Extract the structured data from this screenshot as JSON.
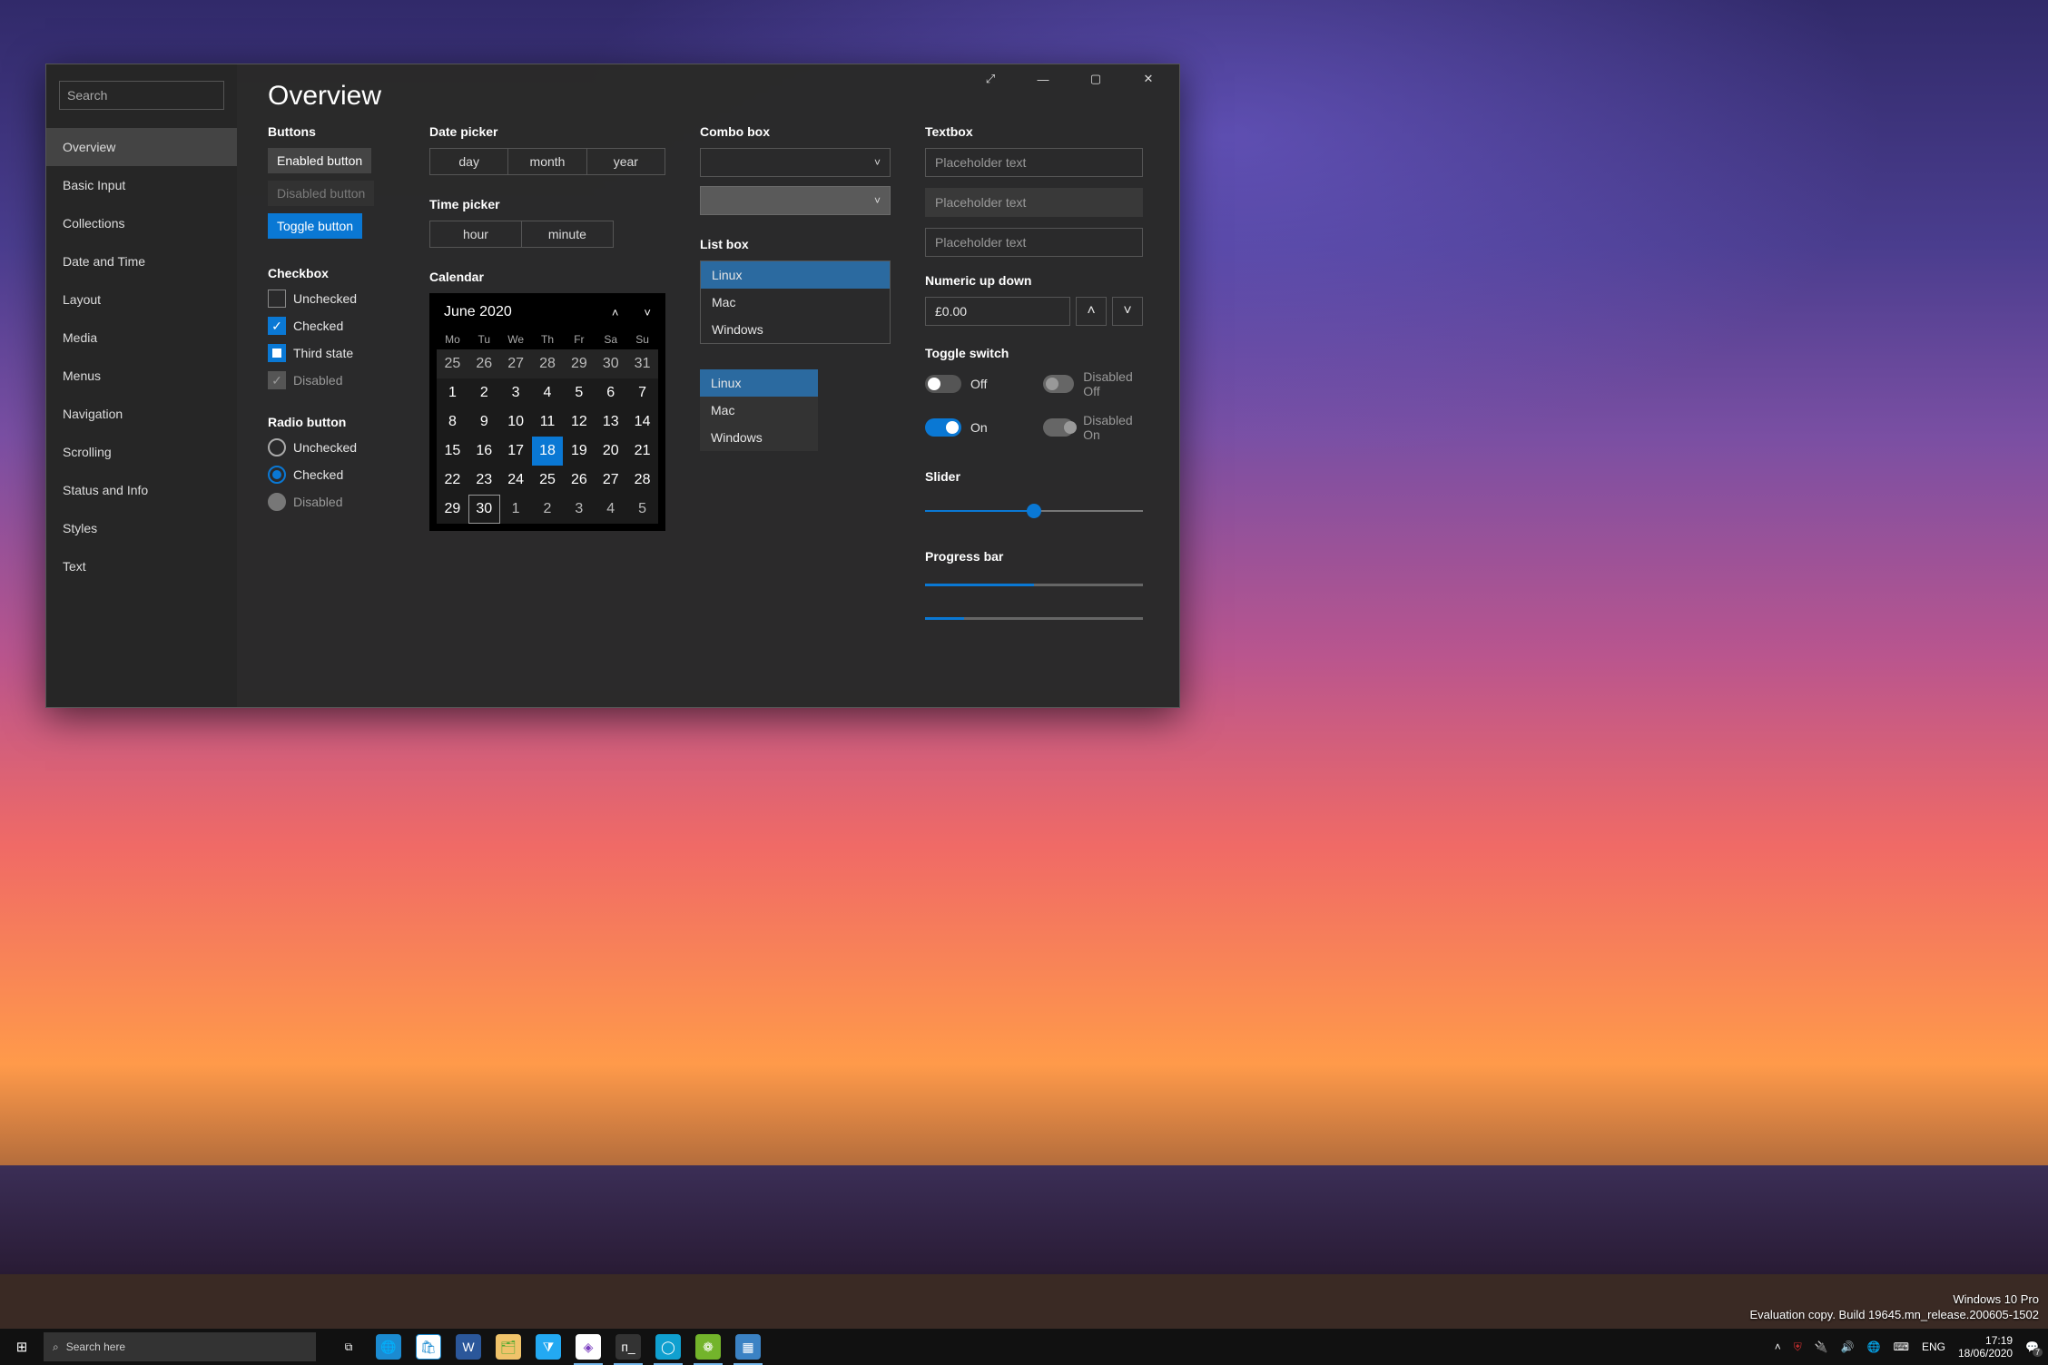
{
  "sidebar": {
    "search_placeholder": "Search",
    "items": [
      "Overview",
      "Basic Input",
      "Collections",
      "Date and Time",
      "Layout",
      "Media",
      "Menus",
      "Navigation",
      "Scrolling",
      "Status and Info",
      "Styles",
      "Text"
    ],
    "active_index": 0
  },
  "page_title": "Overview",
  "buttons": {
    "heading": "Buttons",
    "enabled_label": "Enabled button",
    "disabled_label": "Disabled button",
    "toggle_label": "Toggle button"
  },
  "checkbox": {
    "heading": "Checkbox",
    "unchecked_label": "Unchecked",
    "checked_label": "Checked",
    "third_label": "Third state",
    "disabled_label": "Disabled"
  },
  "radio": {
    "heading": "Radio button",
    "unchecked_label": "Unchecked",
    "checked_label": "Checked",
    "disabled_label": "Disabled"
  },
  "datepicker": {
    "heading": "Date picker",
    "day": "day",
    "month": "month",
    "year": "year"
  },
  "timepicker": {
    "heading": "Time picker",
    "hour": "hour",
    "minute": "minute"
  },
  "calendar": {
    "heading": "Calendar",
    "month_label": "June 2020",
    "dow": [
      "Mo",
      "Tu",
      "We",
      "Th",
      "Fr",
      "Sa",
      "Su"
    ],
    "days": [
      {
        "n": "25",
        "cls": "prev"
      },
      {
        "n": "26",
        "cls": "prev"
      },
      {
        "n": "27",
        "cls": "prev"
      },
      {
        "n": "28",
        "cls": "prev"
      },
      {
        "n": "29",
        "cls": "prev"
      },
      {
        "n": "30",
        "cls": "prev"
      },
      {
        "n": "31",
        "cls": "prev"
      },
      {
        "n": "1"
      },
      {
        "n": "2"
      },
      {
        "n": "3"
      },
      {
        "n": "4"
      },
      {
        "n": "5"
      },
      {
        "n": "6"
      },
      {
        "n": "7"
      },
      {
        "n": "8"
      },
      {
        "n": "9"
      },
      {
        "n": "10"
      },
      {
        "n": "11"
      },
      {
        "n": "12"
      },
      {
        "n": "13"
      },
      {
        "n": "14"
      },
      {
        "n": "15"
      },
      {
        "n": "16"
      },
      {
        "n": "17"
      },
      {
        "n": "18",
        "cls": "selected"
      },
      {
        "n": "19"
      },
      {
        "n": "20"
      },
      {
        "n": "21"
      },
      {
        "n": "22"
      },
      {
        "n": "23"
      },
      {
        "n": "24"
      },
      {
        "n": "25"
      },
      {
        "n": "26"
      },
      {
        "n": "27"
      },
      {
        "n": "28"
      },
      {
        "n": "29"
      },
      {
        "n": "30",
        "cls": "today"
      },
      {
        "n": "1",
        "cls": "next"
      },
      {
        "n": "2",
        "cls": "next"
      },
      {
        "n": "3",
        "cls": "next"
      },
      {
        "n": "4",
        "cls": "next"
      },
      {
        "n": "5",
        "cls": "next"
      }
    ]
  },
  "combobox": {
    "heading": "Combo box"
  },
  "listbox": {
    "heading": "List box",
    "items": [
      "Linux",
      "Mac",
      "Windows"
    ],
    "selected_index": 0,
    "items2": [
      "Linux",
      "Mac",
      "Windows"
    ],
    "selected_index2": 0
  },
  "textbox": {
    "heading": "Textbox",
    "placeholder": "Placeholder text",
    "placeholder_ro": "Placeholder text",
    "placeholder3": "Placeholder text"
  },
  "numeric": {
    "heading": "Numeric up down",
    "value": "£0.00"
  },
  "toggleswitch": {
    "heading": "Toggle switch",
    "off": "Off",
    "on": "On",
    "disabled_off": "Disabled Off",
    "disabled_on": "Disabled On"
  },
  "slider": {
    "heading": "Slider",
    "value_pct": 50
  },
  "progress": {
    "heading": "Progress bar",
    "bar1_pct": 50,
    "bar2_pct": 18
  },
  "taskbar": {
    "search_placeholder": "Search here",
    "time": "17:19",
    "date": "18/06/2020",
    "lang": "ENG",
    "notif_badge": "7",
    "os_line1": "Windows 10 Pro",
    "os_line2": "Evaluation copy. Build 19645.mn_release.200605-1502"
  }
}
